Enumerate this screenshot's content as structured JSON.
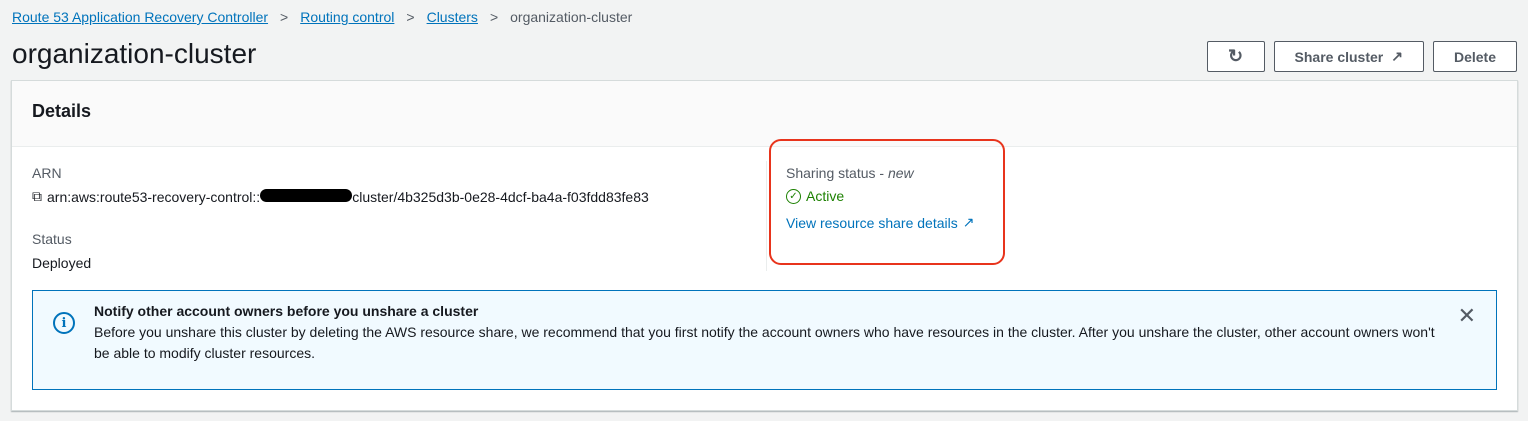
{
  "breadcrumb": {
    "items": [
      "Route 53 Application Recovery Controller",
      "Routing control",
      "Clusters"
    ],
    "current": "organization-cluster"
  },
  "page_title": "organization-cluster",
  "buttons": {
    "refresh_icon": "refresh-icon",
    "share": "Share cluster",
    "delete": "Delete"
  },
  "details": {
    "title": "Details",
    "arn_label": "ARN",
    "arn_prefix": "arn:aws:route53-recovery-control::",
    "arn_suffix": "cluster/4b325d3b-0e28-4dcf-ba4a-f03fdd83fe83",
    "status_label": "Status",
    "status_value": "Deployed",
    "sharing_label": "Sharing status - ",
    "sharing_new": "new",
    "sharing_value": "Active",
    "sharing_link": "View resource share details",
    "colors": {
      "success": "#1d8102",
      "link": "#0073bb",
      "highlight": "#e8341c"
    }
  },
  "alert": {
    "title": "Notify other account owners before you unshare a cluster",
    "body": "Before you unshare this cluster by deleting the AWS resource share, we recommend that you first notify the account owners who have resources in the cluster. After you unshare the cluster, other account owners won't be able to modify cluster resources."
  }
}
